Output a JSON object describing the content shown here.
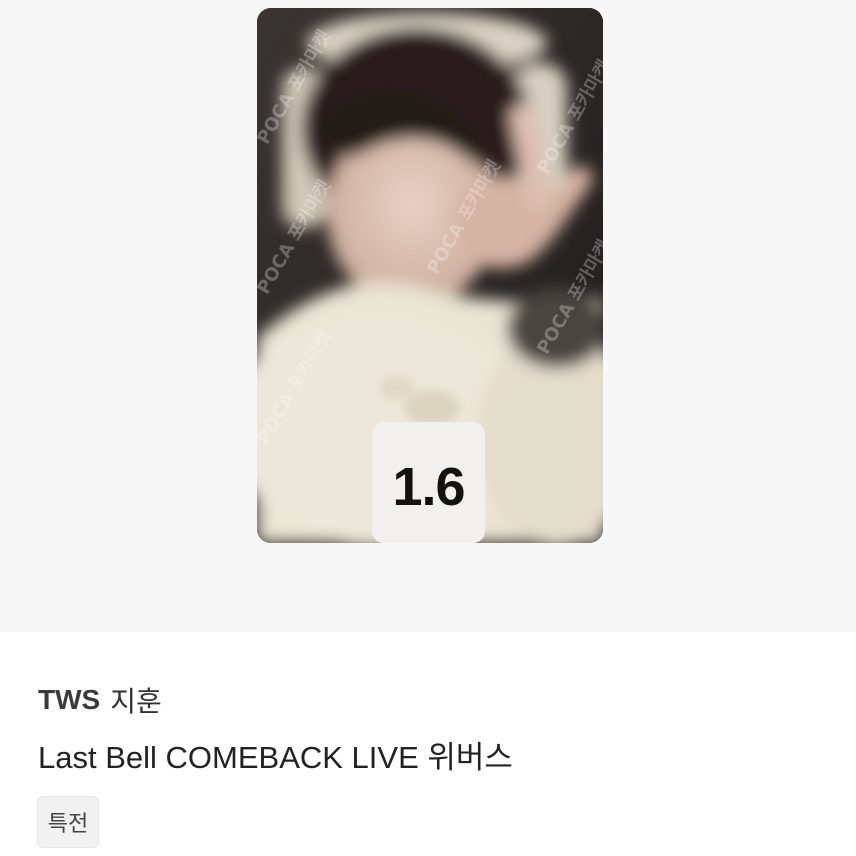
{
  "listing": {
    "image": {
      "alt": "photocard",
      "watermark": "POCA 포카마켓",
      "price_sticker": "1.6"
    },
    "artist_group": "TWS",
    "artist_member": "지훈",
    "title": "Last Bell COMEBACK LIVE 위버스",
    "tag": "특전"
  },
  "colors": {
    "hero_background": "#f7f7f7",
    "page_background": "#ffffff",
    "tag_background": "#f1f1f1",
    "text_primary": "#222222"
  }
}
